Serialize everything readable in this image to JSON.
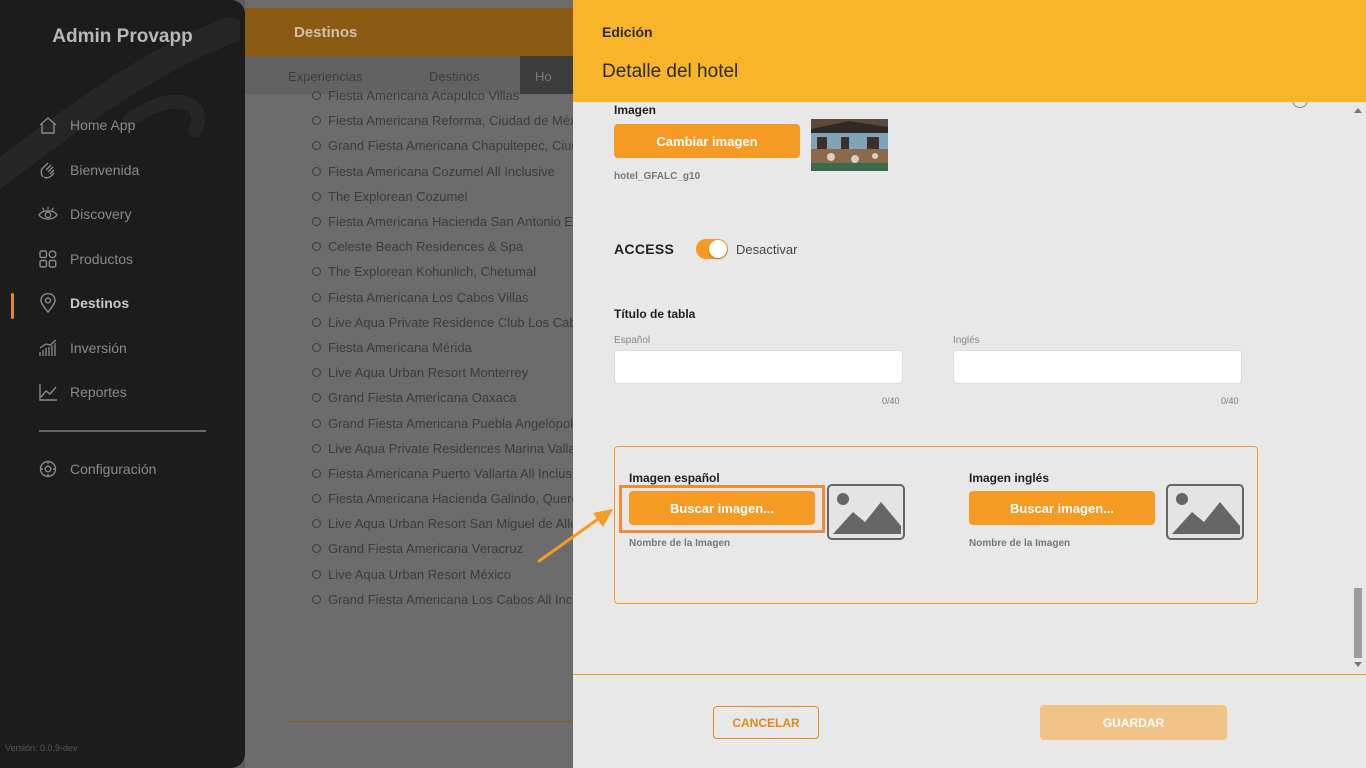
{
  "sidebar": {
    "brand": "Admin Provapp",
    "items": [
      {
        "label": "Home App",
        "icon": "home-icon"
      },
      {
        "label": "Bienvenida",
        "icon": "wave-hand-icon"
      },
      {
        "label": "Discovery",
        "icon": "eye-icon"
      },
      {
        "label": "Productos",
        "icon": "grid-icon"
      },
      {
        "label": "Destinos",
        "icon": "location-pin-icon",
        "active": true
      },
      {
        "label": "Inversión",
        "icon": "bar-chart-icon"
      },
      {
        "label": "Reportes",
        "icon": "line-chart-icon"
      }
    ],
    "settings": {
      "label": "Configuración",
      "icon": "gear-icon"
    },
    "version": "Versión: 0.0.9-dev"
  },
  "background": {
    "header_title": "Destinos",
    "tabs": [
      "Experiencias",
      "Destinos",
      "Ho"
    ],
    "hotels": [
      "Fiesta Americana Acapulco Villas",
      "Fiesta Americana Reforma, Ciudad de México",
      "Grand Fiesta Americana Chapultepec, Ciudad de México",
      "Fiesta Americana Cozumel All Inclusive",
      "The Explorean Cozumel",
      "Fiesta Americana Hacienda San Antonio El Puente",
      "Celeste Beach Residences & Spa",
      "The Explorean Kohunlich, Chetumal",
      "Fiesta Americana Los Cabos Villas",
      "Live Aqua Private Residence Club Los Cabos",
      "Fiesta Americana Mérida",
      "Live Aqua Urban Resort Monterrey",
      "Grand Fiesta Americana Oaxaca",
      "Grand Fiesta Americana Puebla Angelópolis",
      "Live Aqua Private Residences Marina Vallarta",
      "Fiesta Americana Puerto Vallarta All Inclusive",
      "Fiesta Americana Hacienda Galindo, Querétaro",
      "Live Aqua Urban Resort San Miguel de Allende",
      "Grand Fiesta Americana Veracruz",
      "Live Aqua Urban Resort México",
      "Grand Fiesta Americana Los Cabos All Inclusive"
    ]
  },
  "modal": {
    "kicker": "Edición",
    "title": "Detalle del hotel",
    "image_section": {
      "label": "Imagen",
      "change_button": "Cambiar imagen",
      "filename": "hotel_GFALC_g10"
    },
    "access": {
      "label": "ACCESS",
      "toggle_on": true,
      "toggle_text": "Desactivar"
    },
    "table_title": {
      "label": "Título de tabla",
      "spanish": {
        "label": "Español",
        "value": "",
        "counter": "0/40"
      },
      "english": {
        "label": "Inglés",
        "value": "",
        "counter": "0/40"
      }
    },
    "images_lang": {
      "spanish": {
        "label": "Imagen español",
        "button": "Buscar imagen...",
        "name_hint": "Nombre de la Imagen"
      },
      "english": {
        "label": "Imagen inglés",
        "button": "Buscar imagen...",
        "name_hint": "Nombre de la Imagen"
      }
    },
    "footer": {
      "cancel": "CANCELAR",
      "save": "GUARDAR"
    }
  },
  "colors": {
    "accent": "#f59a23",
    "header": "#f8b529",
    "save_disabled": "#f2c386",
    "sidebar_bg": "#1c1c1c"
  }
}
